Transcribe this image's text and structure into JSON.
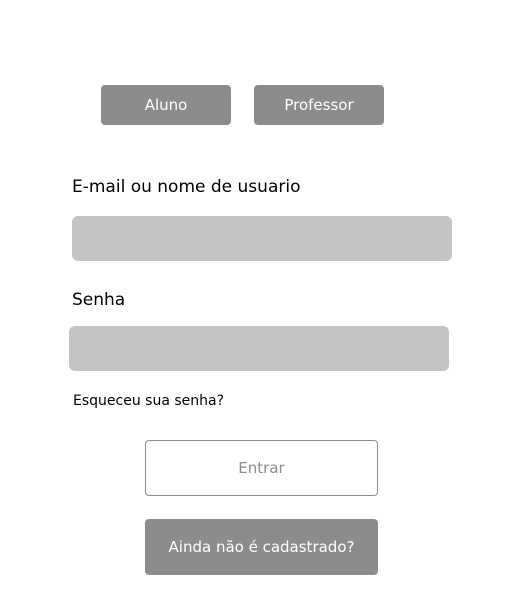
{
  "roles": {
    "aluno_label": "Aluno",
    "professor_label": "Professor"
  },
  "form": {
    "email_label": "E-mail ou nome de usuario",
    "email_value": "",
    "password_label": "Senha",
    "password_value": "",
    "forgot_password": "Esqueceu sua senha?",
    "submit_label": "Entrar",
    "register_label": "Ainda não é cadastrado?"
  },
  "colors": {
    "button_gray": "#8c8c8c",
    "input_gray": "#c4c4c4",
    "background": "#ffffff"
  }
}
